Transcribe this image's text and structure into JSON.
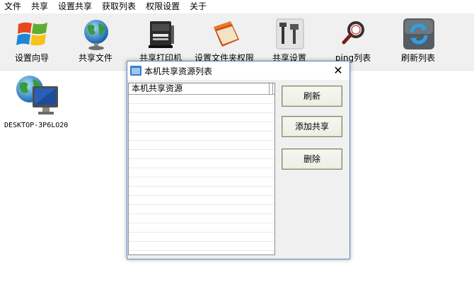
{
  "menu": [
    "文件",
    "共享",
    "设置共享",
    "获取列表",
    "权限设置",
    "关于"
  ],
  "toolbar": [
    {
      "label": "设置向导",
      "icon": "windows-logo-icon"
    },
    {
      "label": "共享文件",
      "icon": "globe-icon"
    },
    {
      "label": "共享打印机",
      "icon": "printer-icon"
    },
    {
      "label": "设置文件夹权限",
      "icon": "folder-book-icon"
    },
    {
      "label": "共享设置",
      "icon": "tools-icon"
    },
    {
      "label": "ping列表",
      "icon": "magnifier-icon"
    },
    {
      "label": "刷新列表",
      "icon": "refresh-icon"
    }
  ],
  "desktop_item": {
    "label": "DESKTOP-3P6LO20",
    "icon": "network-computer-icon"
  },
  "dialog": {
    "title": "本机共享资源列表",
    "close": "✕",
    "column_header": "本机共享资源",
    "buttons": {
      "refresh": "刷新",
      "add": "添加共享",
      "delete": "删除"
    }
  }
}
